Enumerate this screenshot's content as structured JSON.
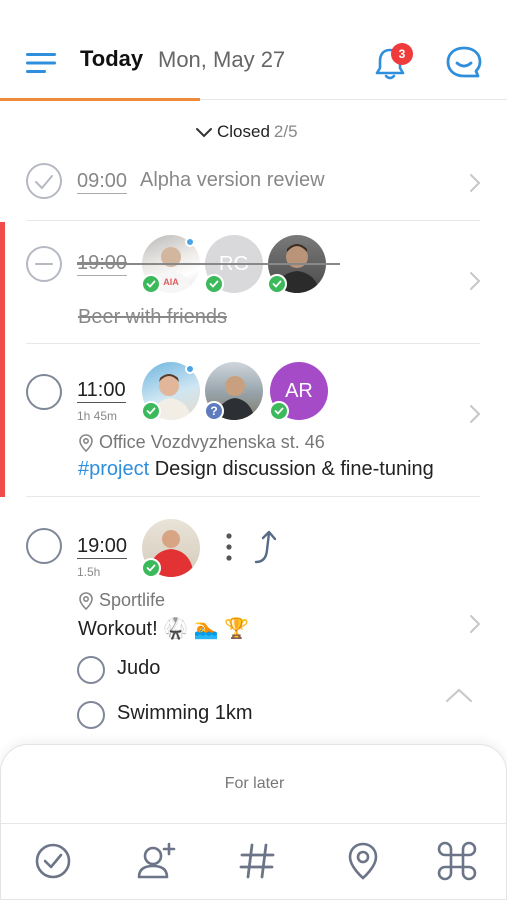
{
  "header": {
    "title": "Today",
    "date": "Mon, May 27",
    "notifications_count": "3",
    "accent_color": "#f08a3c"
  },
  "closed_toggle": {
    "label": "Closed",
    "count": "2/5"
  },
  "tasks": [
    {
      "time": "09:00",
      "title": "Alpha version review",
      "status": "done"
    },
    {
      "time": "19:00",
      "title": "Beer with friends",
      "status": "cancelled",
      "avatars": [
        {
          "kind": "photo",
          "label": "AIA"
        },
        {
          "kind": "initials",
          "initials": "RG"
        },
        {
          "kind": "photo"
        }
      ]
    },
    {
      "time": "11:00",
      "duration": "1h 45m",
      "location": "Office Vozdvyzhenska st. 46",
      "tag": "#project",
      "title": "Design discussion & fine-tuning",
      "avatars": [
        {
          "kind": "photo"
        },
        {
          "kind": "photo"
        },
        {
          "kind": "initials",
          "initials": "AR"
        }
      ]
    },
    {
      "time": "19:00",
      "duration": "1.5h",
      "location": "Sportlife",
      "title": "Workout! 🥋 🏊 🏆",
      "subtasks": [
        {
          "label": "Judo"
        },
        {
          "label": "Swimming 1km"
        }
      ]
    }
  ],
  "bottom_sheet": {
    "label": "For later",
    "tools": [
      "check-circle-icon",
      "add-person-icon",
      "hashtag-icon",
      "location-pin-icon",
      "command-icon"
    ]
  },
  "colors": {
    "red_bar": "#ef4b4b",
    "link_blue": "#2f8fdc",
    "success_green": "#3cb95b",
    "badge_red": "#ef3b3b"
  }
}
